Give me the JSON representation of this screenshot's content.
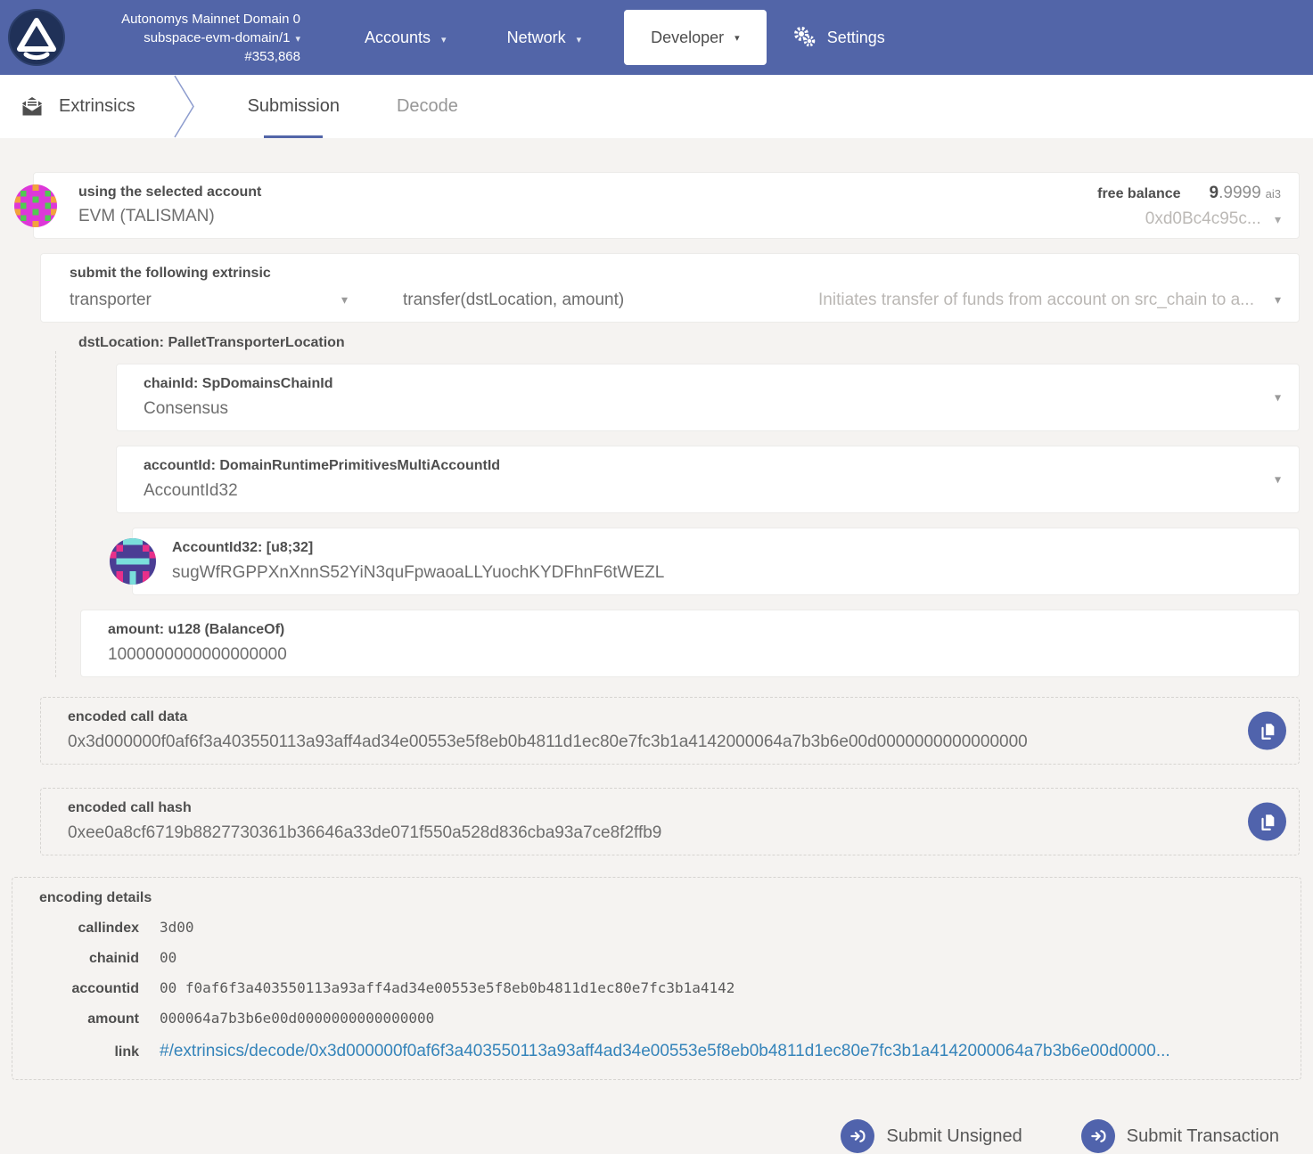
{
  "header": {
    "network_name": "Autonomys Mainnet Domain 0",
    "chain": "subspace-evm-domain/1",
    "block_number": "#353,868",
    "nav": {
      "accounts": "Accounts",
      "network": "Network",
      "developer": "Developer",
      "settings": "Settings"
    }
  },
  "tabbar": {
    "section_title": "Extrinsics",
    "tabs": [
      {
        "label": "Submission",
        "active": true
      },
      {
        "label": "Decode",
        "active": false
      }
    ]
  },
  "account": {
    "label": "using the selected account",
    "name": "EVM (TALISMAN)",
    "free_balance_label": "free balance",
    "balance_int": "9",
    "balance_frac": ".9999",
    "balance_unit": "ai3",
    "address_short": "0xd0Bc4c95c..."
  },
  "extrinsic": {
    "label": "submit the following extrinsic",
    "section": "transporter",
    "method": "transfer(dstLocation, amount)",
    "method_description": "Initiates transfer of funds from account on src_chain to a..."
  },
  "params": {
    "dst_location_label": "dstLocation: PalletTransporterLocation",
    "chain_id": {
      "label": "chainId: SpDomainsChainId",
      "value": "Consensus"
    },
    "account_id": {
      "label": "accountId: DomainRuntimePrimitivesMultiAccountId",
      "value": "AccountId32"
    },
    "account_id32": {
      "label": "AccountId32: [u8;32]",
      "value": "sugWfRGPPXnXnnS52YiN3quFpwaoaLLYuochKYDFhnF6tWEZL"
    },
    "amount": {
      "label": "amount: u128 (BalanceOf)",
      "value": "1000000000000000000"
    }
  },
  "encoded_call_data": {
    "label": "encoded call data",
    "value": "0x3d000000f0af6f3a403550113a93aff4ad34e00553e5f8eb0b4811d1ec80e7fc3b1a4142000064a7b3b6e00d0000000000000000"
  },
  "encoded_call_hash": {
    "label": "encoded call hash",
    "value": "0xee0a8cf6719b8827730361b36646a33de071f550a528d836cba93a7ce8f2ffb9"
  },
  "encoding_details": {
    "label": "encoding details",
    "rows": [
      {
        "key": "callindex",
        "value": "3d00"
      },
      {
        "key": "chainid",
        "value": "00"
      },
      {
        "key": "accountid",
        "value": "00 f0af6f3a403550113a93aff4ad34e00553e5f8eb0b4811d1ec80e7fc3b1a4142"
      },
      {
        "key": "amount",
        "value": "000064a7b3b6e00d0000000000000000"
      }
    ],
    "link_label": "link",
    "link_value": "#/extrinsics/decode/0x3d000000f0af6f3a403550113a93aff4ad34e00553e5f8eb0b4811d1ec80e7fc3b1a4142000064a7b3b6e00d0000..."
  },
  "actions": {
    "submit_unsigned": "Submit Unsigned",
    "submit_transaction": "Submit Transaction"
  },
  "icons": [
    "autonomys-logo",
    "chevron-down-icon",
    "gear-icon",
    "mail-icon",
    "account-identicon",
    "accountid32-identicon",
    "copy-icon",
    "sign-in-icon"
  ],
  "colors": {
    "header_bg": "#5265a8",
    "accent": "#5265a8",
    "button": "#5063ac",
    "link": "#3584ba",
    "page_bg": "#f5f3f1"
  }
}
